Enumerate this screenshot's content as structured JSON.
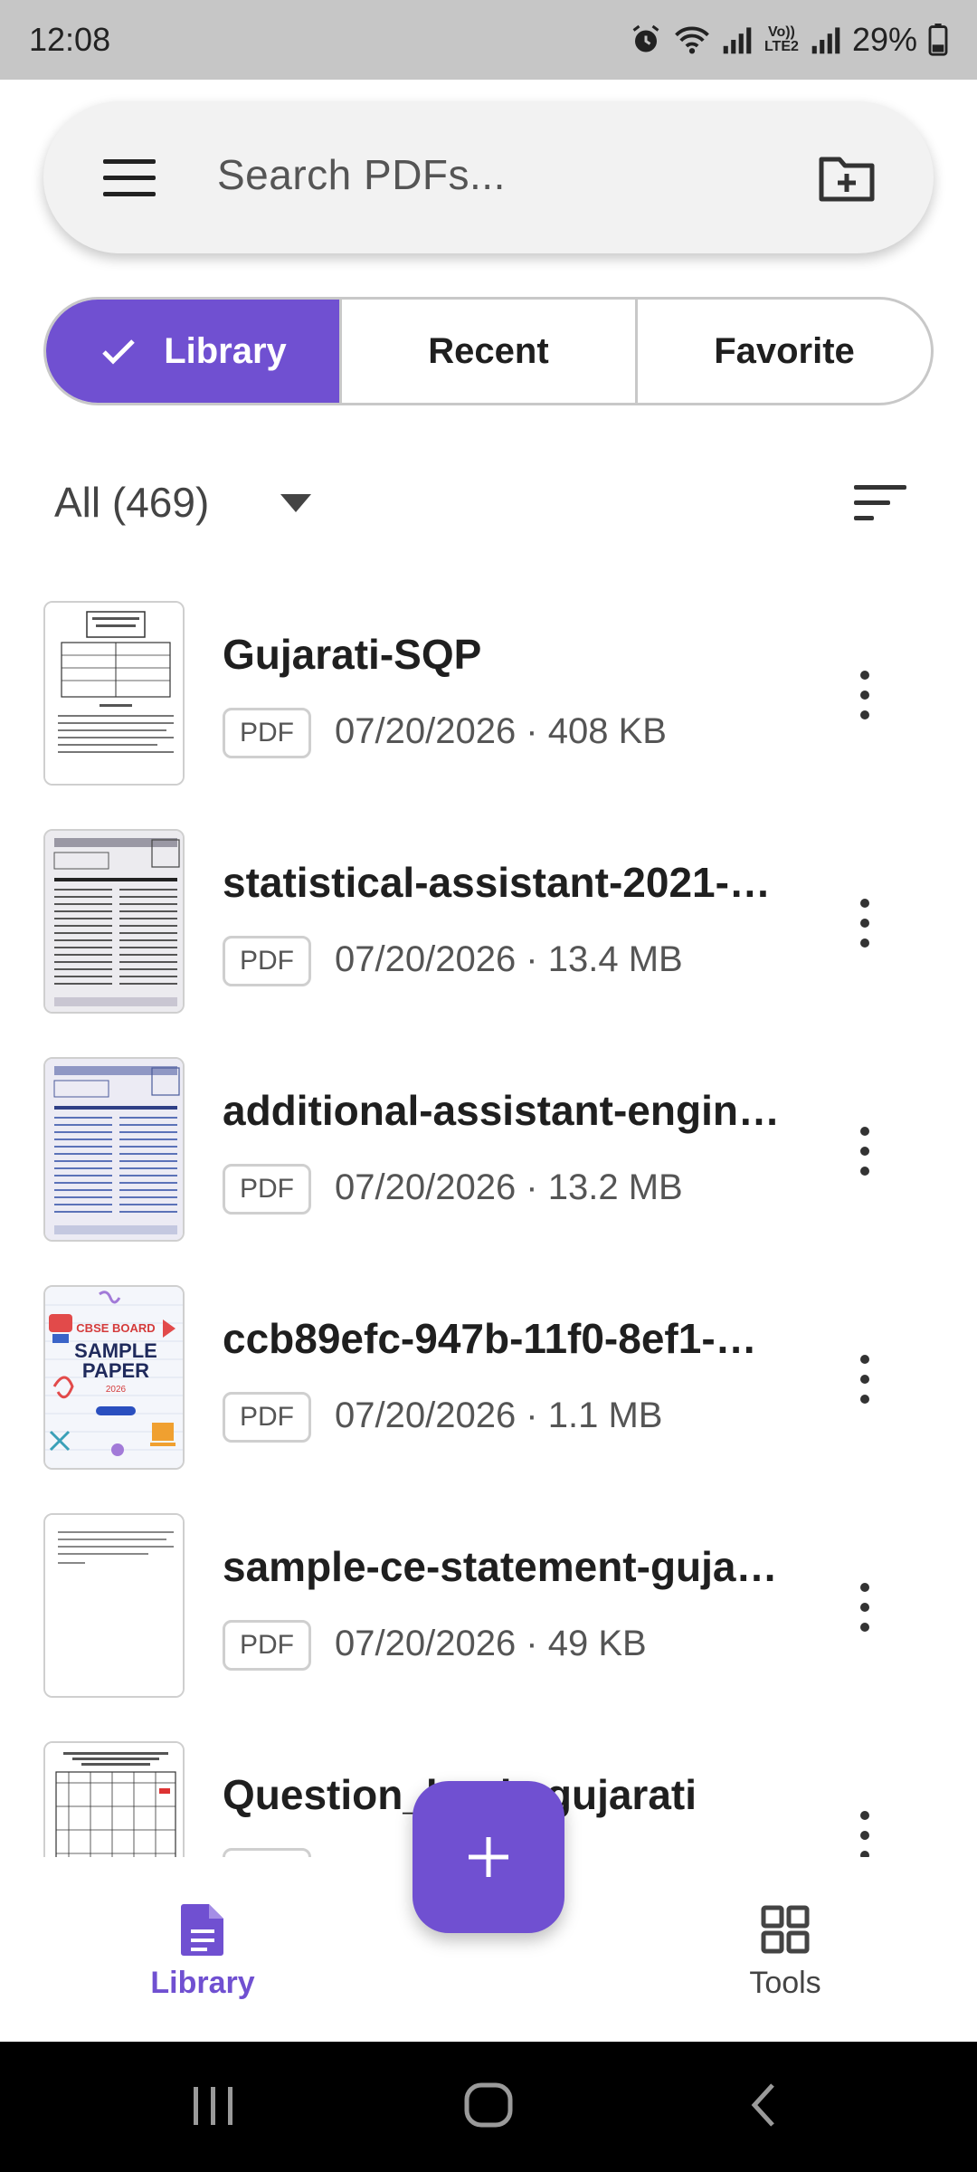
{
  "status_bar": {
    "time": "12:08",
    "battery": "29%",
    "icons": [
      "alarm-icon",
      "wifi-icon",
      "signal-icon",
      "volte-icon",
      "signal-icon",
      "battery-icon"
    ],
    "network_label": "Vo)) LTE2"
  },
  "search": {
    "placeholder": "Search PDFs...",
    "menu_icon": "menu-icon",
    "action_icon": "new-folder-icon"
  },
  "tabs": [
    {
      "label": "Library",
      "active": true
    },
    {
      "label": "Recent",
      "active": false
    },
    {
      "label": "Favorite",
      "active": false
    }
  ],
  "filter": {
    "label": "All (469)",
    "sort_icon": "sort-icon"
  },
  "files": [
    {
      "name": "Gujarati-SQP",
      "type": "PDF",
      "meta": "07/20/2026 · 408 KB",
      "thumb": "doc"
    },
    {
      "name": "statistical-assistant-2021-…",
      "type": "PDF",
      "meta": "07/20/2026 · 13.4 MB",
      "thumb": "scan"
    },
    {
      "name": "additional-assistant-engin…",
      "type": "PDF",
      "meta": "07/20/2026 · 13.2 MB",
      "thumb": "scan-blue"
    },
    {
      "name": "ccb89efc-947b-11f0-8ef1-…",
      "type": "PDF",
      "meta": "07/20/2026 · 1.1 MB",
      "thumb": "cover"
    },
    {
      "name": "sample-ce-statement-guja…",
      "type": "PDF",
      "meta": "07/20/2026 · 49 KB",
      "thumb": "blank"
    },
    {
      "name": "Question_bank_gujarati",
      "type": "PDF",
      "meta": "",
      "thumb": "table"
    }
  ],
  "thumb_cover": {
    "board": "CBSE BOARD",
    "title_line1": "SAMPLE",
    "title_line2": "PAPER",
    "year": "2026"
  },
  "fab": {
    "icon": "plus-icon"
  },
  "bottom_nav": [
    {
      "label": "Library",
      "icon": "document-icon",
      "active": true
    },
    {
      "label": "Tools",
      "icon": "grid-icon",
      "active": false
    }
  ],
  "colors": {
    "accent": "#7050d1",
    "status_bar": "#c6c6c6",
    "system_nav": "#000000"
  }
}
